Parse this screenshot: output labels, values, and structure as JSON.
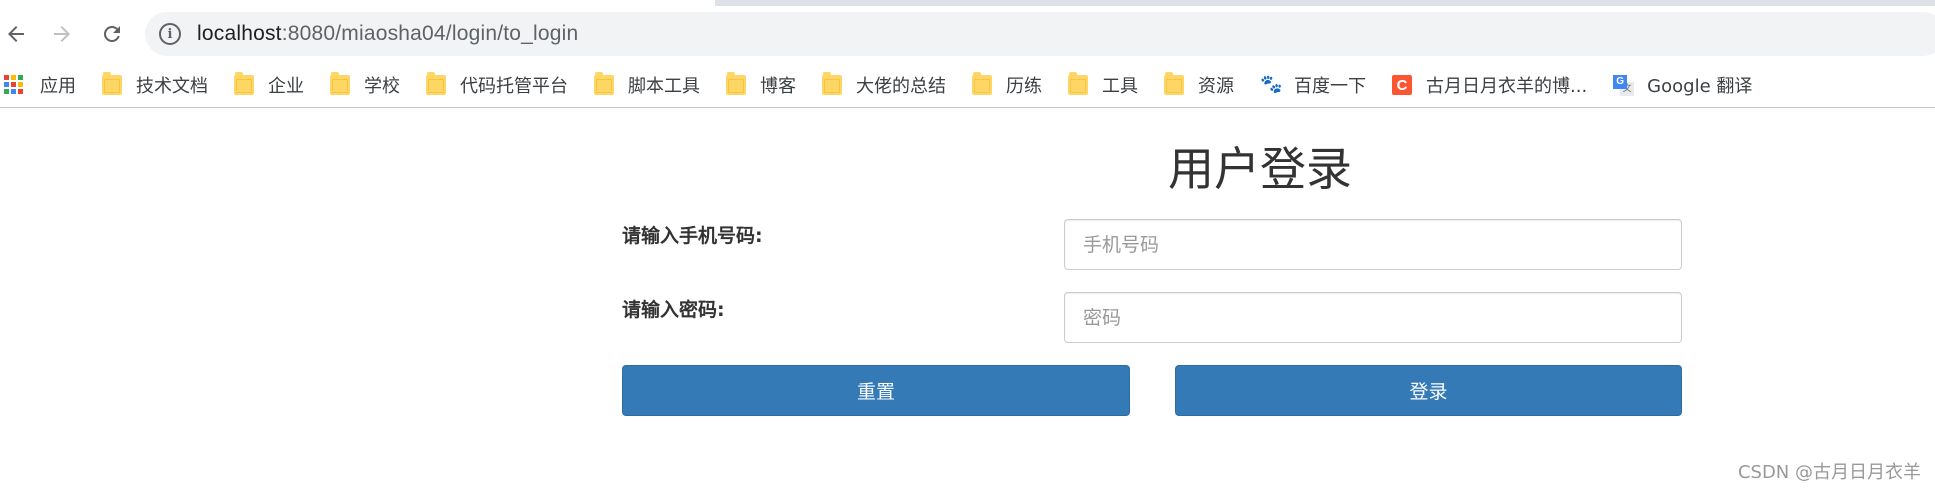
{
  "browser": {
    "url_host": "localhost",
    "url_path": ":8080/miaosha04/login/to_login",
    "info_icon": "i",
    "bookmarks": [
      {
        "label": "应用",
        "icon": "apps-grid-icon"
      },
      {
        "label": "技术文档",
        "icon": "folder-icon"
      },
      {
        "label": "企业",
        "icon": "folder-icon"
      },
      {
        "label": "学校",
        "icon": "folder-icon"
      },
      {
        "label": "代码托管平台",
        "icon": "folder-icon"
      },
      {
        "label": "脚本工具",
        "icon": "folder-icon"
      },
      {
        "label": "博客",
        "icon": "folder-icon"
      },
      {
        "label": "大佬的总结",
        "icon": "folder-icon"
      },
      {
        "label": "历练",
        "icon": "folder-icon"
      },
      {
        "label": "工具",
        "icon": "folder-icon"
      },
      {
        "label": "资源",
        "icon": "folder-icon"
      },
      {
        "label": "百度一下",
        "icon": "baidu-icon"
      },
      {
        "label": "古月日月衣羊的博...",
        "icon": "csdn-icon"
      },
      {
        "label": "Google 翻译",
        "icon": "google-translate-icon"
      }
    ],
    "icon_glyphs": {
      "baidu": "🐾",
      "csdn": "C",
      "gtrans_front": "G",
      "gtrans_back": "文"
    }
  },
  "login": {
    "title": "用户登录",
    "mobile_label": "请输入手机号码:",
    "mobile_placeholder": "手机号码",
    "password_label": "请输入密码:",
    "password_placeholder": "密码",
    "reset_label": "重置",
    "submit_label": "登录"
  },
  "watermark": "CSDN @古月日月衣羊",
  "colors": {
    "primary_button": "#337ab7",
    "folder": "#fdd663",
    "csdn": "#fc5531",
    "baidu": "#2932e1"
  }
}
